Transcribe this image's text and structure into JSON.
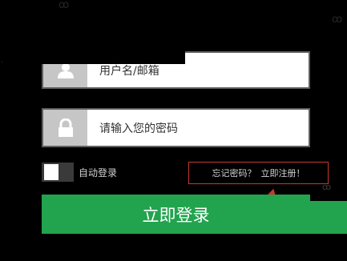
{
  "form": {
    "username_placeholder": "用户名/邮箱",
    "password_placeholder": "请输入您的密码",
    "remember_label": "自动登录",
    "forgot_link": "忘记密码？",
    "register_link": "立即注册！",
    "login_button": "立即登录",
    "remember_checked": false
  },
  "icons": {
    "username": "user-icon",
    "password": "lock-icon",
    "decorations": [
      "chain-link-icon",
      "chain-link-icon",
      "chain-link-icon"
    ]
  },
  "colors": {
    "background": "#000000",
    "primary": "#22a34e",
    "highlight_border": "#c8372f",
    "icon_box": "#c6c6c6",
    "text_light": "#d2d2d2"
  }
}
